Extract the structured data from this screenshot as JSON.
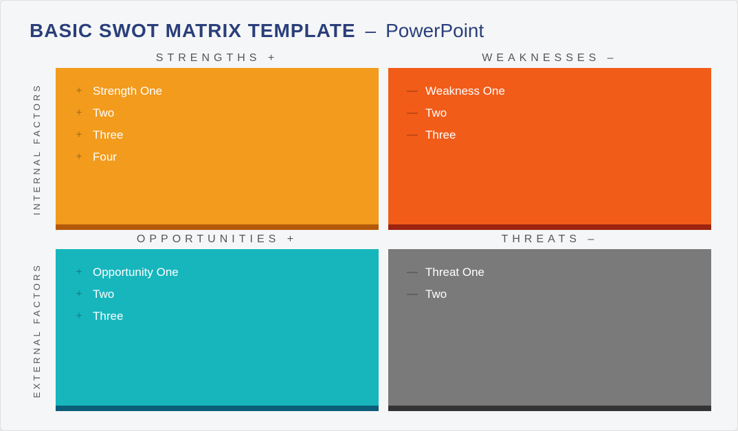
{
  "title": {
    "bold": "BASIC SWOT MATRIX TEMPLATE",
    "dash": "–",
    "app": "PowerPoint"
  },
  "labels": {
    "internal": "INTERNAL FACTORS",
    "external": "EXTERNAL FACTORS",
    "strengths": "STRENGTHS  +",
    "weaknesses": "WEAKNESSES  –",
    "opportunities": "OPPORTUNITIES  +",
    "threats": "THREATS  –"
  },
  "bullets": {
    "plus": "+",
    "minus": "—"
  },
  "strengths": {
    "i0": "Strength One",
    "i1": "Two",
    "i2": "Three",
    "i3": "Four"
  },
  "weaknesses": {
    "i0": "Weakness One",
    "i1": "Two",
    "i2": "Three"
  },
  "opportunities": {
    "i0": "Opportunity One",
    "i1": "Two",
    "i2": "Three"
  },
  "threats": {
    "i0": "Threat One",
    "i1": "Two"
  }
}
